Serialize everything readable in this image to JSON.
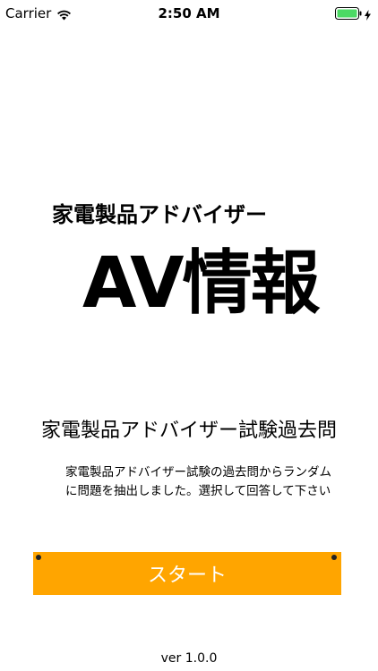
{
  "status_bar": {
    "carrier": "Carrier",
    "time": "2:50 AM",
    "icons": [
      "wifi-icon",
      "battery-icon",
      "charging-bolt-icon"
    ],
    "battery_color": "#4cd964"
  },
  "hero": {
    "subtitle": "家電製品アドバイザー",
    "title": "AV情報"
  },
  "exam": {
    "title": "家電製品アドバイザー試験過去問",
    "description": "家電製品アドバイザー試験の過去問からランダムに問題を抽出しました。選択して回答して下さい"
  },
  "start_button": {
    "label": "スタート",
    "color": "#ffa500"
  },
  "footer": {
    "version": "ver 1.0.0"
  }
}
